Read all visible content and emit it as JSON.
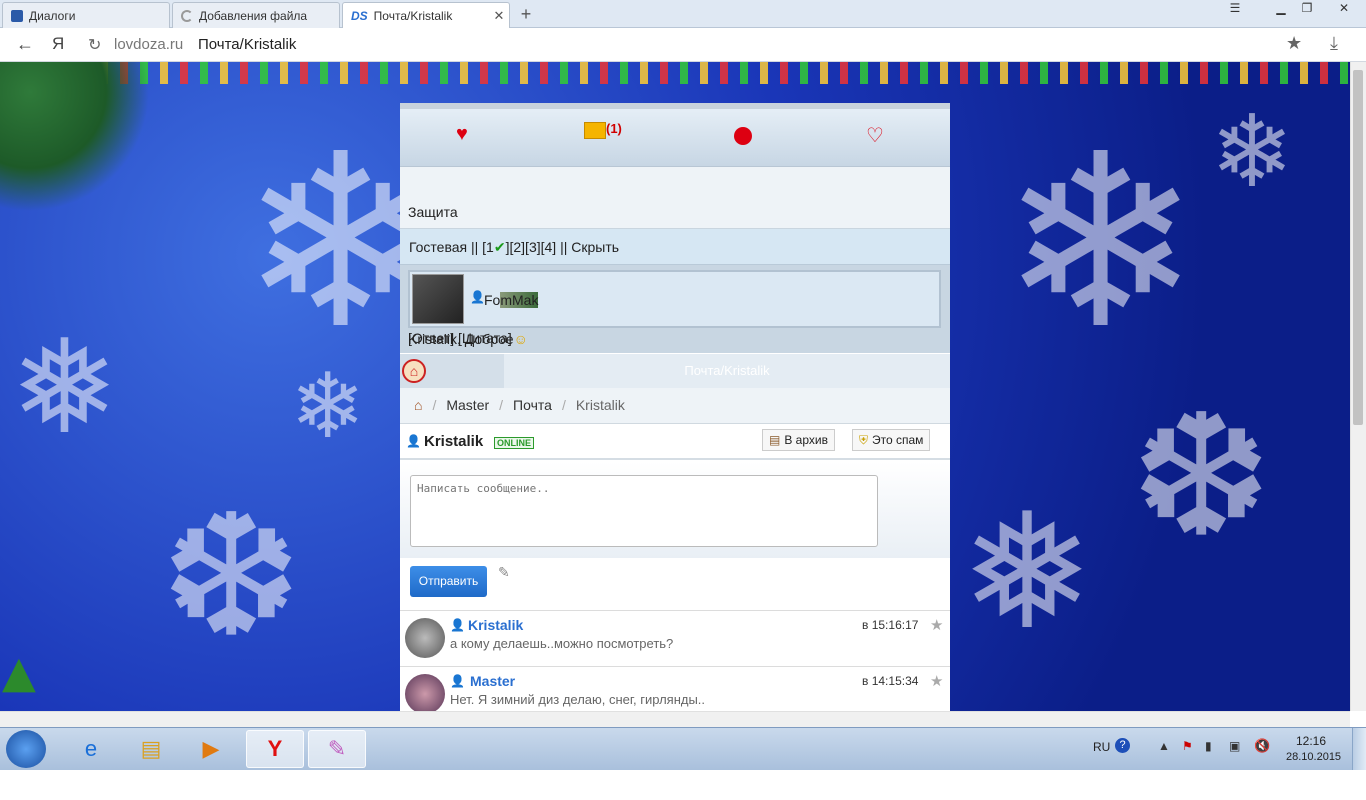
{
  "browser": {
    "tabs": [
      {
        "label": "Диалоги",
        "icon": "chat-icon"
      },
      {
        "label": "Добавления файла",
        "icon": "loading-icon"
      },
      {
        "label": "Почта/Kristalik",
        "icon": "ds-logo-icon",
        "logo_text": "DS",
        "active": true
      }
    ],
    "new_tab_symbol": "+",
    "address": {
      "domain": "lovdoza.ru",
      "path": "Почта/Kristalik",
      "engine_letter": "Я"
    }
  },
  "nav_icons": {
    "mail_count": "(1)"
  },
  "protect_label": "Защита",
  "guest": {
    "text": "Гостевая || [1",
    "check": "✔",
    "rest": "][2][3][4] || Скрыть"
  },
  "post": {
    "author": "FomMak",
    "text": "Kristalik, Доброе",
    "actions": "[Ответ] [Цитата]"
  },
  "title_bar": "Почта/Kristalik",
  "breadcrumb": {
    "items": [
      "Master",
      "Почта",
      "Kristalik"
    ],
    "sep": "/"
  },
  "user": {
    "name": "Kristalik",
    "status": "ONLINE"
  },
  "buttons": {
    "archive": "В архив",
    "spam": "Это спам",
    "send": "Отправить"
  },
  "compose": {
    "placeholder": "Написать сообщение.."
  },
  "messages": [
    {
      "author": "Kristalik",
      "time": "в 15:16:17",
      "text": "а кому делаешь..можно посмотреть?"
    },
    {
      "author": "Master",
      "time": "в 14:15:34",
      "text": "Нет. Я зимний диз делаю, снег, гирлянды.."
    }
  ],
  "taskbar": {
    "lang": "RU",
    "time": "12:16",
    "date": "28.10.2015"
  },
  "colors": {
    "accent": "#2a6fd0",
    "online": "#2b9a2b",
    "mail_count": "#d00000",
    "page_bg": "#1a36b8"
  }
}
